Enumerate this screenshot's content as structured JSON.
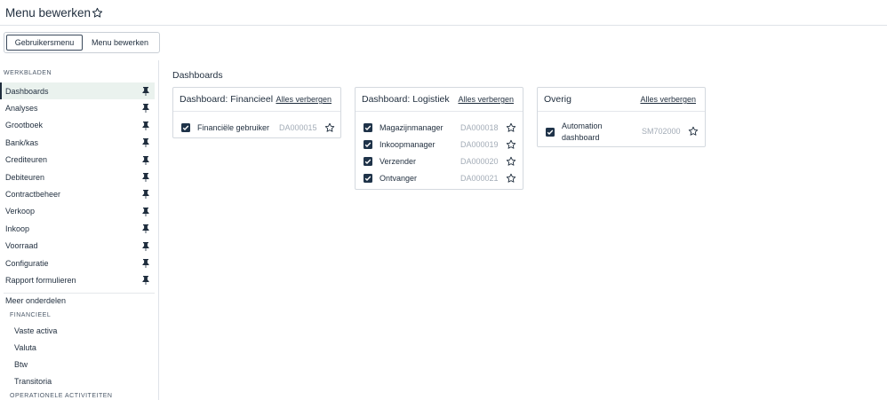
{
  "header": {
    "title": "Menu bewerken",
    "star_icon": "star-outline-icon"
  },
  "tabs": [
    {
      "label": "Gebruikersmenu",
      "active": true
    },
    {
      "label": "Menu bewerken",
      "active": false
    }
  ],
  "sidebar": {
    "section_label": "WERKBLADEN",
    "items": [
      {
        "label": "Dashboards",
        "active": true
      },
      {
        "label": "Analyses"
      },
      {
        "label": "Grootboek"
      },
      {
        "label": "Bank/kas"
      },
      {
        "label": "Crediteuren"
      },
      {
        "label": "Debiteuren"
      },
      {
        "label": "Contractbeheer"
      },
      {
        "label": "Verkoop"
      },
      {
        "label": "Inkoop"
      },
      {
        "label": "Voorraad"
      },
      {
        "label": "Configuratie"
      },
      {
        "label": "Rapport formulieren"
      }
    ],
    "pin_icon": "pin-icon",
    "more": {
      "title": "Meer onderdelen",
      "groups": [
        {
          "label": "FINANCIEEL",
          "items": [
            "Vaste activa",
            "Valuta",
            "Btw",
            "Transitoria"
          ]
        },
        {
          "label": "OPERATIONELE ACTIVITEITEN",
          "items": []
        }
      ]
    }
  },
  "main": {
    "title": "Dashboards",
    "cards": [
      {
        "title": "Dashboard: Financieel",
        "hide_label": "Alles verbergen",
        "rows": [
          {
            "label": "Financiële gebruiker",
            "code": "DA000015",
            "checked": true
          }
        ]
      },
      {
        "title": "Dashboard: Logistiek",
        "hide_label": "Alles verbergen",
        "rows": [
          {
            "label": "Magazijnmanager",
            "code": "DA000018",
            "checked": true
          },
          {
            "label": "Inkoopmanager",
            "code": "DA000019",
            "checked": true
          },
          {
            "label": "Verzender",
            "code": "DA000020",
            "checked": true
          },
          {
            "label": "Ontvanger",
            "code": "DA000021",
            "checked": true
          }
        ]
      },
      {
        "title": "Overig",
        "hide_label": "Alles verbergen",
        "rows": [
          {
            "label_line1": "Automation",
            "label_line2": "dashboard",
            "code": "SM702000",
            "checked": true
          }
        ]
      }
    ]
  },
  "colors": {
    "accent_dark": "#1f3349",
    "active_bg": "#eaf2ee",
    "muted_text": "#a3acb7"
  }
}
